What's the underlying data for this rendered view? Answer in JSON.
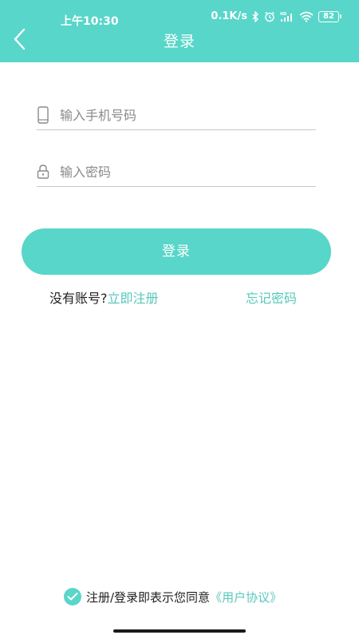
{
  "status_bar": {
    "time": "上午10:30",
    "network_speed": "0.1K/s",
    "battery": "82",
    "icons": [
      "bluetooth-icon",
      "alarm-icon",
      "hd-signal-icon",
      "wifi-icon",
      "battery-icon"
    ]
  },
  "header": {
    "title": "登录",
    "back_icon": "chevron-left-icon"
  },
  "form": {
    "phone": {
      "placeholder": "输入手机号码",
      "value": "",
      "icon": "phone-icon"
    },
    "password": {
      "placeholder": "输入密码",
      "value": "",
      "icon": "lock-icon"
    },
    "login_label": "登录"
  },
  "links": {
    "no_account": "没有账号?",
    "register_now": "立即注册",
    "forgot_password": "忘记密码"
  },
  "agreement": {
    "text": "注册/登录即表示您同意",
    "link": "《用户协议》",
    "checked": true
  },
  "colors": {
    "accent": "#58D6C9",
    "link": "#58C8BC"
  }
}
